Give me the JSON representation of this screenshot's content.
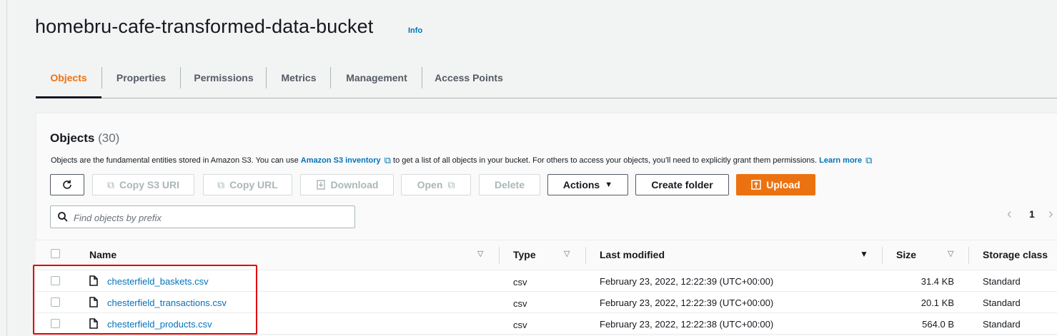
{
  "header": {
    "title": "homebru-cafe-transformed-data-bucket",
    "info_label": "Info"
  },
  "tabs": [
    {
      "label": "Objects",
      "active": true
    },
    {
      "label": "Properties"
    },
    {
      "label": "Permissions"
    },
    {
      "label": "Metrics"
    },
    {
      "label": "Management"
    },
    {
      "label": "Access Points"
    }
  ],
  "objects_panel": {
    "title": "Objects",
    "count": "(30)",
    "description_prefix": "Objects are the fundamental entities stored in Amazon S3. You can use ",
    "inventory_link": "Amazon S3 inventory",
    "description_middle": " to get a list of all objects in your bucket. For others to access your objects, you’ll need to explicitly grant them permissions. ",
    "learn_more_link": "Learn more"
  },
  "toolbar": {
    "refresh_icon": "refresh-icon",
    "copy_s3_uri": "Copy S3 URI",
    "copy_url": "Copy URL",
    "download": "Download",
    "open": "Open",
    "delete": "Delete",
    "actions": "Actions",
    "create_folder": "Create folder",
    "upload": "Upload"
  },
  "search": {
    "placeholder": "Find objects by prefix",
    "value": ""
  },
  "pagination": {
    "current_page": "1"
  },
  "table": {
    "columns": [
      "Name",
      "Type",
      "Last modified",
      "Size",
      "Storage class"
    ],
    "rows": [
      {
        "name": "chesterfield_baskets.csv",
        "type": "csv",
        "last_modified": "February 23, 2022, 12:22:39 (UTC+00:00)",
        "size": "31.4 KB",
        "storage_class": "Standard"
      },
      {
        "name": "chesterfield_transactions.csv",
        "type": "csv",
        "last_modified": "February 23, 2022, 12:22:39 (UTC+00:00)",
        "size": "20.1 KB",
        "storage_class": "Standard"
      },
      {
        "name": "chesterfield_products.csv",
        "type": "csv",
        "last_modified": "February 23, 2022, 12:22:38 (UTC+00:00)",
        "size": "564.0 B",
        "storage_class": "Standard"
      }
    ]
  },
  "colors": {
    "accent": "#ec7211",
    "link": "#0073bb",
    "highlight_box": "#e00000"
  }
}
